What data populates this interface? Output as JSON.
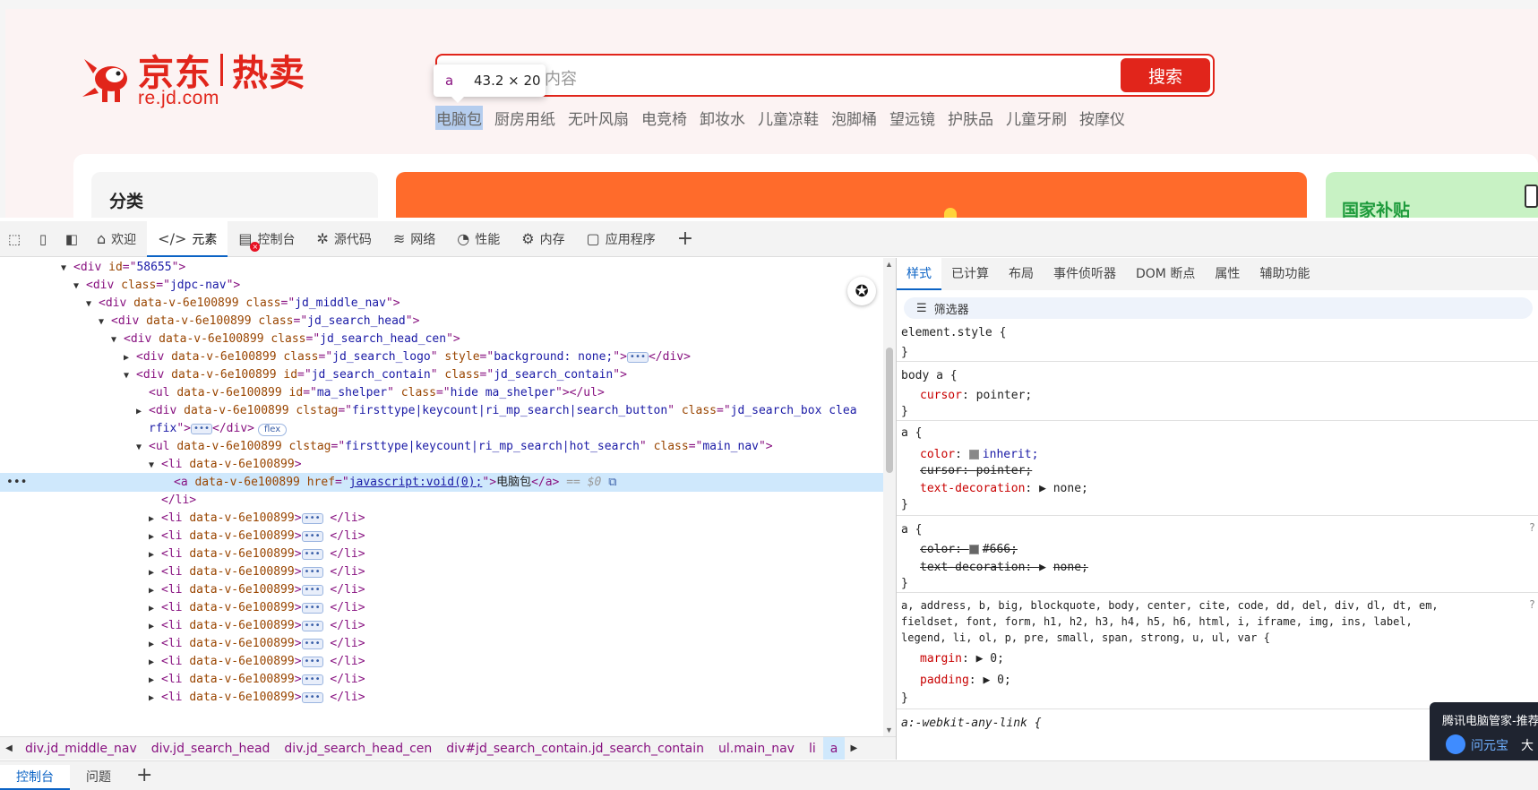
{
  "page": {
    "logo": {
      "brand_left": "京东",
      "brand_right": "热卖",
      "url": "re.jd.com"
    },
    "search": {
      "text": "内容",
      "button": "搜索"
    },
    "hot_items": [
      "电脑包",
      "厨房用纸",
      "无叶风扇",
      "电竞椅",
      "卸妆水",
      "儿童凉鞋",
      "泡脚桶",
      "望远镜",
      "护肤品",
      "儿童牙刷",
      "按摩仪"
    ],
    "tooltip": {
      "tag": "a",
      "dims": "43.2 × 20"
    },
    "category_title": "分类",
    "subsidy_title": "国家补贴"
  },
  "toolbar": {
    "tabs": [
      {
        "label": "欢迎",
        "icon": "home-icon"
      },
      {
        "label": "元素",
        "icon": "code-icon"
      },
      {
        "label": "控制台",
        "icon": "console-icon"
      },
      {
        "label": "源代码",
        "icon": "bug-icon"
      },
      {
        "label": "网络",
        "icon": "wifi-icon"
      },
      {
        "label": "性能",
        "icon": "gauge-icon"
      },
      {
        "label": "内存",
        "icon": "chip-icon"
      },
      {
        "label": "应用程序",
        "icon": "app-icon"
      }
    ],
    "active": "元素",
    "add": "+"
  },
  "dom": {
    "l1_id": "58655",
    "l2_class": "jdpc-nav",
    "data_attr": "data-v-6e100899",
    "l3_class": "jd_middle_nav",
    "l4_class": "jd_search_head",
    "l5_class": "jd_search_head_cen",
    "l6_class": "jd_search_logo",
    "l6_style": "background: none;",
    "l7_id": "jd_search_contain",
    "l7_class": "jd_search_contain",
    "l8_id": "ma_shelper",
    "l8_class": "hide ma_shelper",
    "l9_clstag": "firsttype|keycount|ri_mp_search|search_button",
    "l9_class": "jd_search_box clea",
    "l9_wrap": "rfix",
    "l9_badge": "flex",
    "l10_clstag": "firsttype|keycount|ri_mp_search|hot_search",
    "l10_class": "main_nav",
    "l12_href": "javascript:void(0);",
    "l12_text": "电脑包",
    "l12_marker": "== $0",
    "collapsed_li_count": 11
  },
  "breadcrumbs": [
    "div.jd_middle_nav",
    "div.jd_search_head",
    "div.jd_search_head_cen",
    "div#jd_search_contain.jd_search_contain",
    "ul.main_nav",
    "li",
    "a"
  ],
  "styles": {
    "tabs": [
      "样式",
      "已计算",
      "布局",
      "事件侦听器",
      "DOM 断点",
      "属性",
      "辅助功能"
    ],
    "filter": "筛选器",
    "rules": {
      "element_style": "element.style {",
      "body_a": {
        "selector": "body a {",
        "prop": "cursor",
        "value": "pointer;"
      },
      "a1": {
        "selector": "a {",
        "color_value": "inherit;",
        "cursor_prop": "cursor",
        "cursor_value": "pointer;",
        "td_prop": "text-decoration",
        "td_value": "none;"
      },
      "a2": {
        "selector": "a {",
        "color_value": "#666;",
        "td_prop": "text-decoration",
        "td_value": "none;"
      },
      "reset": {
        "line1": "a, address, b, big, blockquote, body, center, cite, code, dd, del, div, dl, dt, em,",
        "line2": "fieldset, font, form, h1, h2, h3, h4, h5, h6, html, i, iframe, img, ins, label,",
        "line3": "legend, li, ol, p, pre, small, span, strong, u, ul, var {",
        "margin": "0;",
        "padding": "0;"
      },
      "webkit": "a:-webkit-any-link {"
    },
    "colors": {
      "inherit_swatch": "#888888",
      "666_swatch": "#666666"
    }
  },
  "notification": {
    "title": "腾讯电脑管家-推荐",
    "brand": "问元宝",
    "tail": "大"
  },
  "drawer": {
    "tabs": [
      "控制台",
      "问题"
    ],
    "add": "+"
  }
}
